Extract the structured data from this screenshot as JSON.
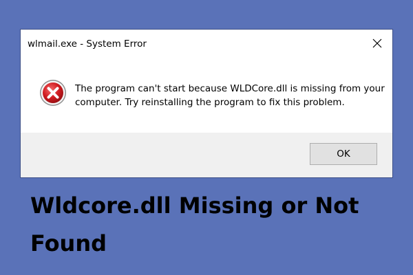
{
  "dialog": {
    "title": "wlmail.exe - System Error",
    "message": "The program can't start because WLDCore.dll is missing from your computer. Try reinstalling the program to fix this problem.",
    "ok_label": "OK",
    "icon": "error-icon",
    "close_icon": "close-icon"
  },
  "headline": {
    "line1": "Wldcore.dll Missing or Not",
    "line2": "Found"
  },
  "colors": {
    "background": "#5a72b8",
    "dialog_bg": "#ffffff",
    "footer_bg": "#f0f0f0",
    "error_red": "#c8171c"
  }
}
